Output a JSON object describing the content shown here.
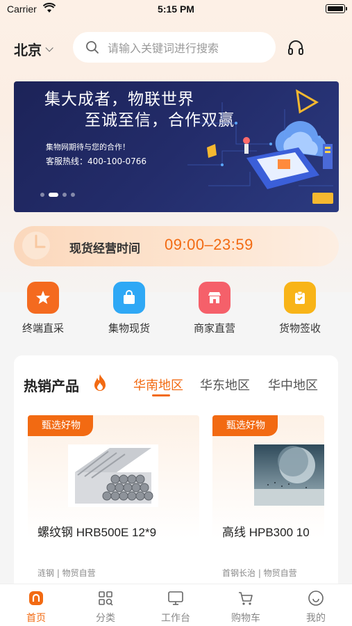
{
  "status_bar": {
    "carrier": "Carrier",
    "time": "5:15 PM"
  },
  "header": {
    "city": "北京",
    "search_placeholder": "请输入关键词进行搜索"
  },
  "banner": {
    "headline_1": "集大成者，物联世界",
    "headline_2": "至诚至信，合作双赢",
    "subline": "集物网期待与您的合作！",
    "hotline": "客服热线：400-100-0766",
    "active_dot": 1
  },
  "hours": {
    "label": "现货经营时间",
    "value": "09:00–23:59"
  },
  "quick_links": [
    {
      "label": "终端直采",
      "icon": "star-icon",
      "color": "#f46a1f"
    },
    {
      "label": "集物现货",
      "icon": "bag-icon",
      "color": "#2fa8f5"
    },
    {
      "label": "商家直营",
      "icon": "store-icon",
      "color": "#f5606a"
    },
    {
      "label": "货物签收",
      "icon": "clipboard-check-icon",
      "color": "#f8b418"
    }
  ],
  "hot_products": {
    "title": "热销产品",
    "tabs": [
      "华南地区",
      "华东地区",
      "华中地区"
    ],
    "active_tab": 0,
    "items": [
      {
        "tag": "甄选好物",
        "name": "螺纹钢 HRB500E 12*9",
        "meta": "涟钢 | 物贸自营"
      },
      {
        "tag": "甄选好物",
        "name": "高线 HPB300 10",
        "meta": "首钢长治 | 物贸自营"
      }
    ]
  },
  "tabbar": {
    "items": [
      {
        "label": "首页",
        "icon": "home-icon",
        "active": true
      },
      {
        "label": "分类",
        "icon": "category-icon",
        "active": false
      },
      {
        "label": "工作台",
        "icon": "monitor-icon",
        "active": false
      },
      {
        "label": "购物车",
        "icon": "cart-icon",
        "active": false
      },
      {
        "label": "我的",
        "icon": "profile-icon",
        "active": false
      }
    ]
  },
  "colors": {
    "accent": "#f26a12",
    "banner_bg": "#1c2358"
  }
}
